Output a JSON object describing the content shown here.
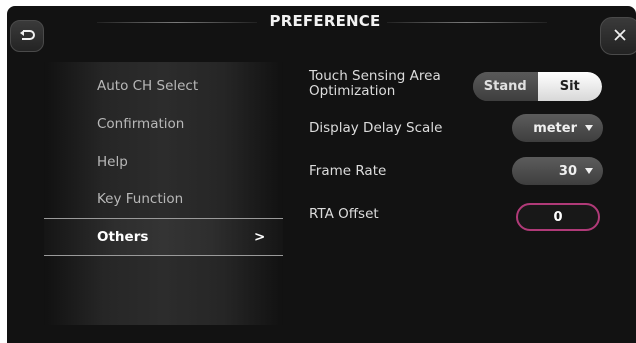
{
  "header": {
    "title": "PREFERENCE",
    "back_icon": "back-arrow-icon",
    "close_icon": "close-icon"
  },
  "sidebar": {
    "items": [
      {
        "label": "Auto CH Select"
      },
      {
        "label": "Confirmation"
      },
      {
        "label": "Help"
      },
      {
        "label": "Key Function"
      },
      {
        "label": "Others",
        "selected": true,
        "chevron": ">"
      }
    ]
  },
  "settings": {
    "touch_sensing": {
      "label_line1": "Touch Sensing Area",
      "label_line2": "Optimization",
      "options": [
        "Stand",
        "Sit"
      ],
      "selected": "Sit"
    },
    "display_delay_scale": {
      "label": "Display Delay Scale",
      "value": "meter"
    },
    "frame_rate": {
      "label": "Frame Rate",
      "value": "30"
    },
    "rta_offset": {
      "label": "RTA Offset",
      "value": "0"
    }
  },
  "colors": {
    "background": "#121212",
    "accent_field_border": "#b03a78",
    "selected_toggle": "#ffffff"
  }
}
